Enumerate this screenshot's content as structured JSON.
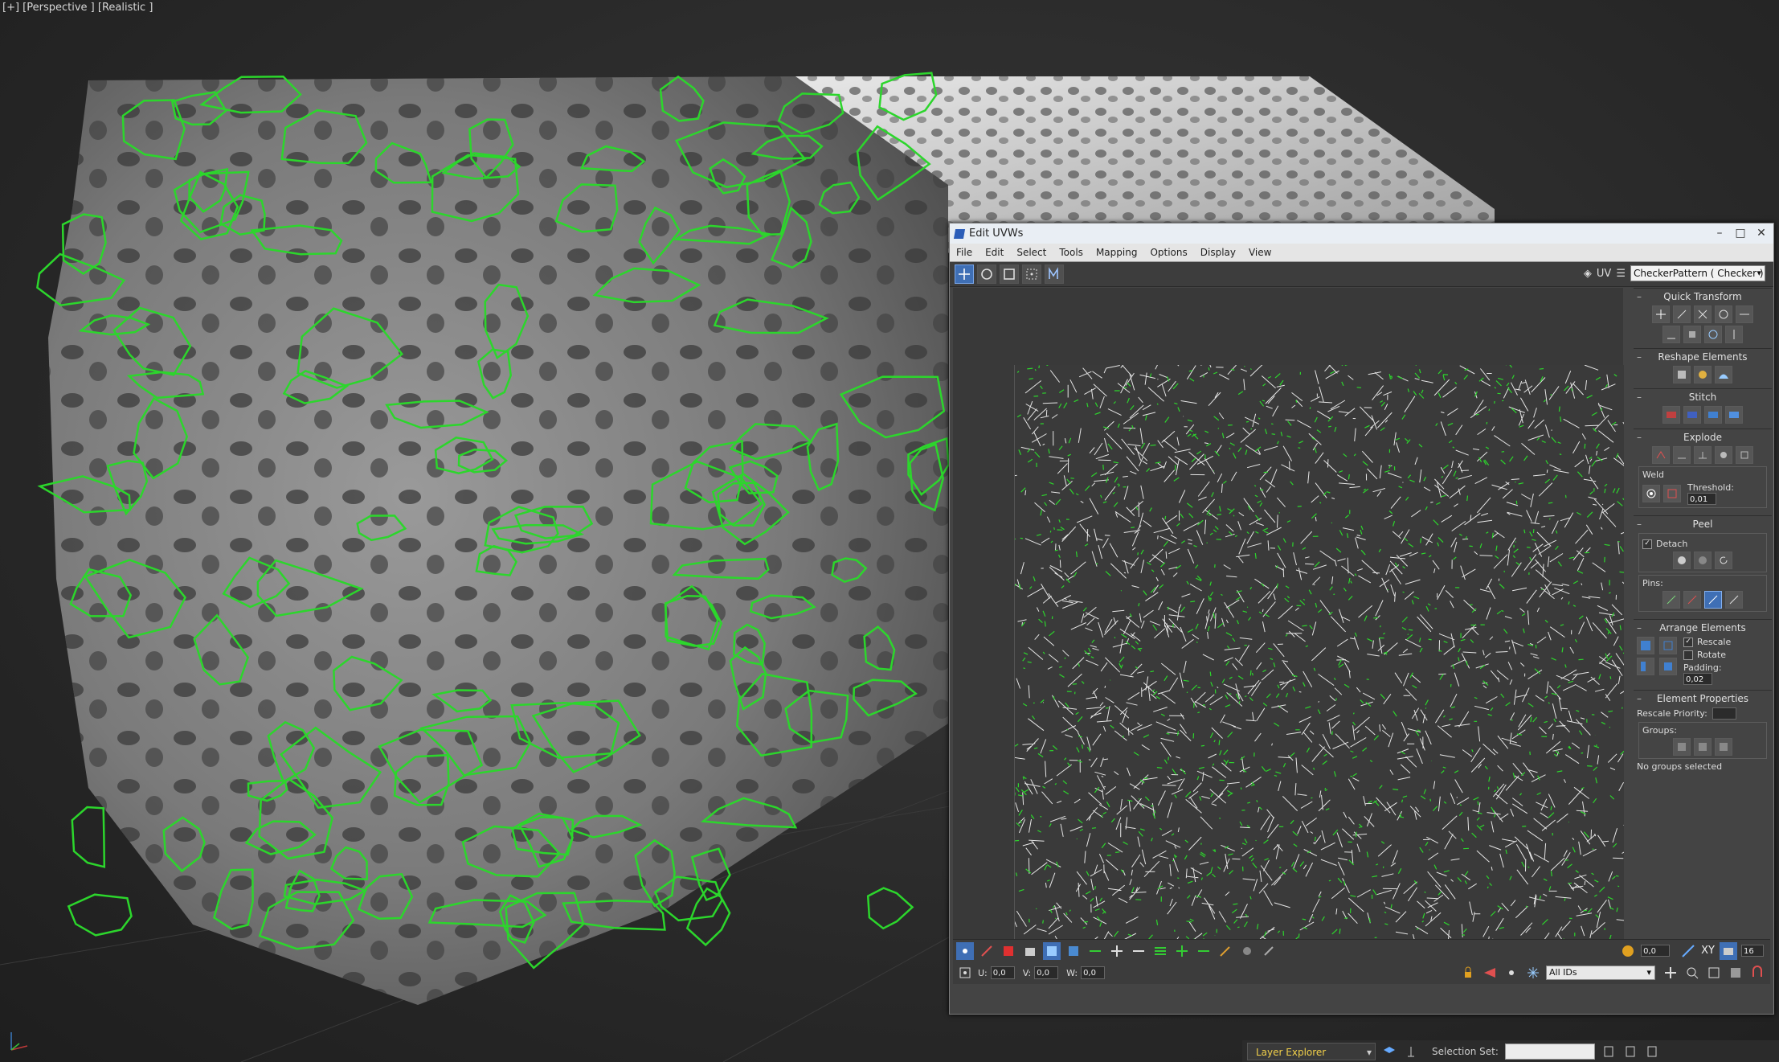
{
  "viewport": {
    "label": "[+] [Perspective ] [Realistic ]"
  },
  "uvw_window": {
    "title": "Edit UVWs",
    "menu": [
      "File",
      "Edit",
      "Select",
      "Tools",
      "Mapping",
      "Options",
      "Display",
      "View"
    ],
    "uv_label": "UV",
    "checker": "CheckerPattern  ( Checker )",
    "rollouts": {
      "quick_transform": "Quick Transform",
      "reshape": "Reshape Elements",
      "stitch": "Stitch",
      "explode": "Explode",
      "weld": "Weld",
      "threshold_label": "Threshold:",
      "threshold_value": "0,01",
      "peel": "Peel",
      "detach": "Detach",
      "pins": "Pins:",
      "arrange": "Arrange Elements",
      "rescale": "Rescale",
      "rotate": "Rotate",
      "padding_label": "Padding:",
      "padding_value": "0,02",
      "element_props": "Element Properties",
      "rescale_priority": "Rescale Priority:",
      "groups": "Groups:",
      "no_groups": "No groups selected"
    },
    "bottom": {
      "value1": "0,0",
      "xy_label": "XY",
      "value16": "16",
      "u_label": "U:",
      "u_value": "0,0",
      "v_label": "V:",
      "v_value": "0,0",
      "w_label": "W:",
      "w_value": "0,0",
      "ids": "All IDs"
    }
  },
  "statusbar": {
    "layer_explorer": "Layer Explorer",
    "selection_set": "Selection Set:"
  },
  "colors": {
    "wire": "#2cd62c",
    "selected": "#3f6fb5"
  }
}
